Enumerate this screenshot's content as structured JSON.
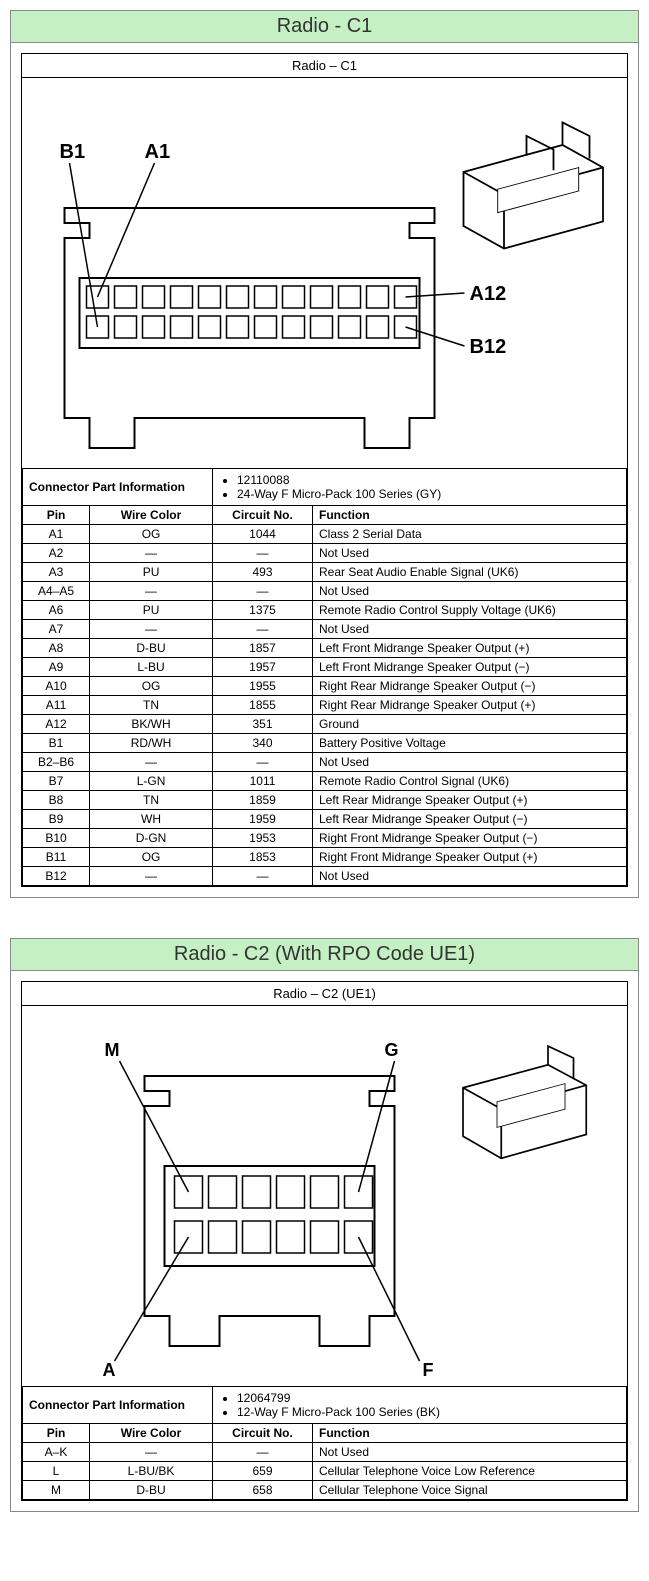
{
  "c1": {
    "header": "Radio - C1",
    "diagram_title": "Radio – C1",
    "labels": {
      "b1": "B1",
      "a1": "A1",
      "a12": "A12",
      "b12": "B12"
    },
    "cpi_label": "Connector Part Information",
    "cpi_items": [
      "12110088",
      "24-Way F Micro-Pack 100 Series (GY)"
    ],
    "columns": {
      "pin": "Pin",
      "wire": "Wire Color",
      "circuit": "Circuit No.",
      "func": "Function"
    },
    "rows": [
      {
        "pin": "A1",
        "wire": "OG",
        "circuit": "1044",
        "func": "Class 2 Serial Data"
      },
      {
        "pin": "A2",
        "wire": "—",
        "circuit": "—",
        "func": "Not Used"
      },
      {
        "pin": "A3",
        "wire": "PU",
        "circuit": "493",
        "func": "Rear Seat Audio Enable Signal (UK6)"
      },
      {
        "pin": "A4–A5",
        "wire": "—",
        "circuit": "—",
        "func": "Not Used"
      },
      {
        "pin": "A6",
        "wire": "PU",
        "circuit": "1375",
        "func": "Remote Radio Control Supply Voltage (UK6)"
      },
      {
        "pin": "A7",
        "wire": "—",
        "circuit": "—",
        "func": "Not Used"
      },
      {
        "pin": "A8",
        "wire": "D-BU",
        "circuit": "1857",
        "func": "Left Front Midrange Speaker Output (+)"
      },
      {
        "pin": "A9",
        "wire": "L-BU",
        "circuit": "1957",
        "func": "Left Front Midrange Speaker Output (−)"
      },
      {
        "pin": "A10",
        "wire": "OG",
        "circuit": "1955",
        "func": "Right Rear Midrange Speaker Output (−)"
      },
      {
        "pin": "A11",
        "wire": "TN",
        "circuit": "1855",
        "func": "Right Rear Midrange Speaker Output (+)"
      },
      {
        "pin": "A12",
        "wire": "BK/WH",
        "circuit": "351",
        "func": "Ground"
      },
      {
        "pin": "B1",
        "wire": "RD/WH",
        "circuit": "340",
        "func": "Battery Positive Voltage"
      },
      {
        "pin": "B2–B6",
        "wire": "—",
        "circuit": "—",
        "func": "Not Used"
      },
      {
        "pin": "B7",
        "wire": "L-GN",
        "circuit": "1011",
        "func": "Remote Radio Control Signal (UK6)"
      },
      {
        "pin": "B8",
        "wire": "TN",
        "circuit": "1859",
        "func": "Left Rear Midrange Speaker Output (+)"
      },
      {
        "pin": "B9",
        "wire": "WH",
        "circuit": "1959",
        "func": "Left Rear Midrange Speaker Output (−)"
      },
      {
        "pin": "B10",
        "wire": "D-GN",
        "circuit": "1953",
        "func": "Right Front Midrange Speaker Output (−)"
      },
      {
        "pin": "B11",
        "wire": "OG",
        "circuit": "1853",
        "func": "Right Front Midrange Speaker Output (+)"
      },
      {
        "pin": "B12",
        "wire": "—",
        "circuit": "—",
        "func": "Not Used"
      }
    ]
  },
  "c2": {
    "header": "Radio - C2 (With RPO Code UE1)",
    "diagram_title": "Radio – C2 (UE1)",
    "labels": {
      "m": "M",
      "g": "G",
      "a": "A",
      "f": "F"
    },
    "cpi_label": "Connector Part Information",
    "cpi_items": [
      "12064799",
      "12-Way F Micro-Pack 100 Series (BK)"
    ],
    "columns": {
      "pin": "Pin",
      "wire": "Wire Color",
      "circuit": "Circuit No.",
      "func": "Function"
    },
    "rows": [
      {
        "pin": "A–K",
        "wire": "—",
        "circuit": "—",
        "func": "Not Used"
      },
      {
        "pin": "L",
        "wire": "L-BU/BK",
        "circuit": "659",
        "func": "Cellular Telephone Voice Low Reference"
      },
      {
        "pin": "M",
        "wire": "D-BU",
        "circuit": "658",
        "func": "Cellular Telephone Voice Signal"
      }
    ]
  }
}
